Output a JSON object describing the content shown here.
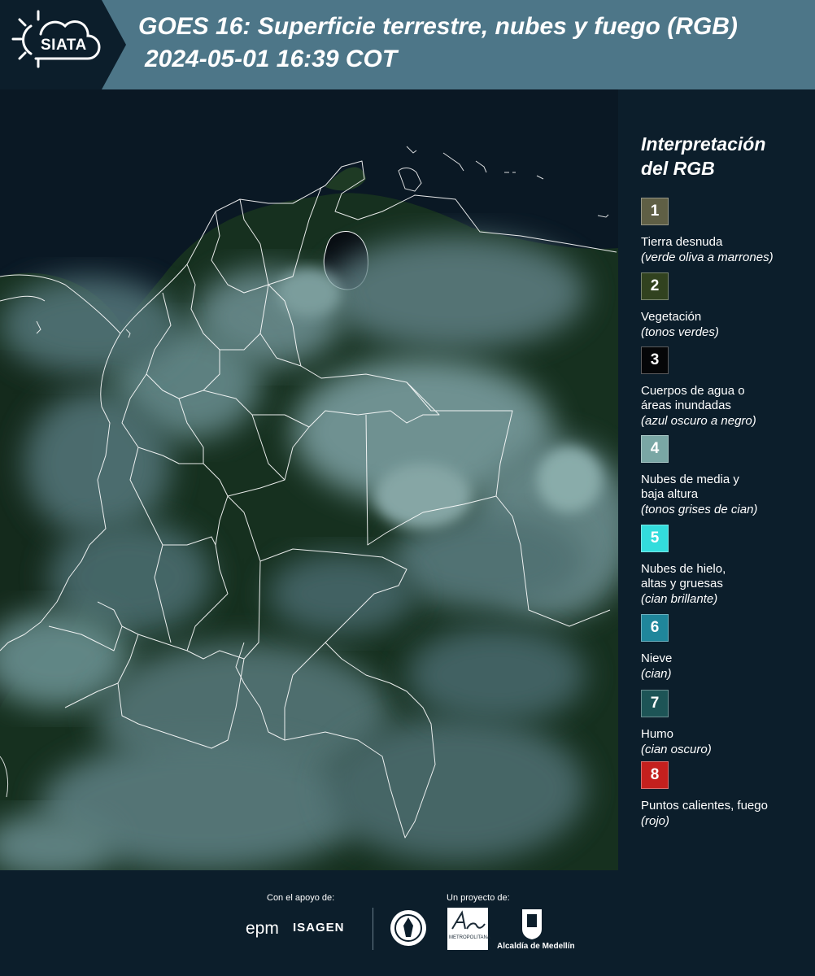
{
  "header": {
    "logo_text": "SIATA",
    "title_line1": "GOES 16: Superficie terrestre, nubes y fuego (RGB)",
    "title_line2": "2024-05-01 16:39 COT"
  },
  "legend": {
    "title_line1": "Interpretación",
    "title_line2": "del RGB",
    "items": [
      {
        "number": "1",
        "label": "Tierra desnuda",
        "sub": "(verde oliva a marrones)",
        "color": "#5f5f45"
      },
      {
        "number": "2",
        "label": "Vegetación",
        "sub": "(tonos verdes)",
        "color": "#31421f"
      },
      {
        "number": "3",
        "label": "Cuerpos de agua o\náreas inundadas",
        "sub": "(azul oscuro a negro)",
        "color": "#050608"
      },
      {
        "number": "4",
        "label": "Nubes de media y\nbaja altura",
        "sub": "(tonos grises de cian)",
        "color": "#7aa7a5"
      },
      {
        "number": "5",
        "label": "Nubes de hielo,\naltas y gruesas",
        "sub": "(cian brillante)",
        "color": "#33dcdc"
      },
      {
        "number": "6",
        "label": "Nieve",
        "sub": "(cian)",
        "color": "#1f869b"
      },
      {
        "number": "7",
        "label": "Humo",
        "sub": "(cian oscuro)",
        "color": "#1d5456"
      },
      {
        "number": "8",
        "label": "Puntos calientes, fuego",
        "sub": "(rojo)",
        "color": "#c4201e"
      }
    ]
  },
  "footer": {
    "support_label": "Con el apoyo de:",
    "project_label": "Un proyecto de:",
    "epm": "epm",
    "isagen": "ISAGEN",
    "alcaldia": "Alcaldía de Medellín"
  },
  "colors": {
    "header_bg": "#4d7688",
    "logo_tab_bg": "#0c1e2b",
    "panel_bg": "#0c1e2b",
    "map_bg": "#0a1824",
    "land": "#16301f",
    "cloud": "#7fa3a6",
    "border_line": "#ffffff"
  }
}
